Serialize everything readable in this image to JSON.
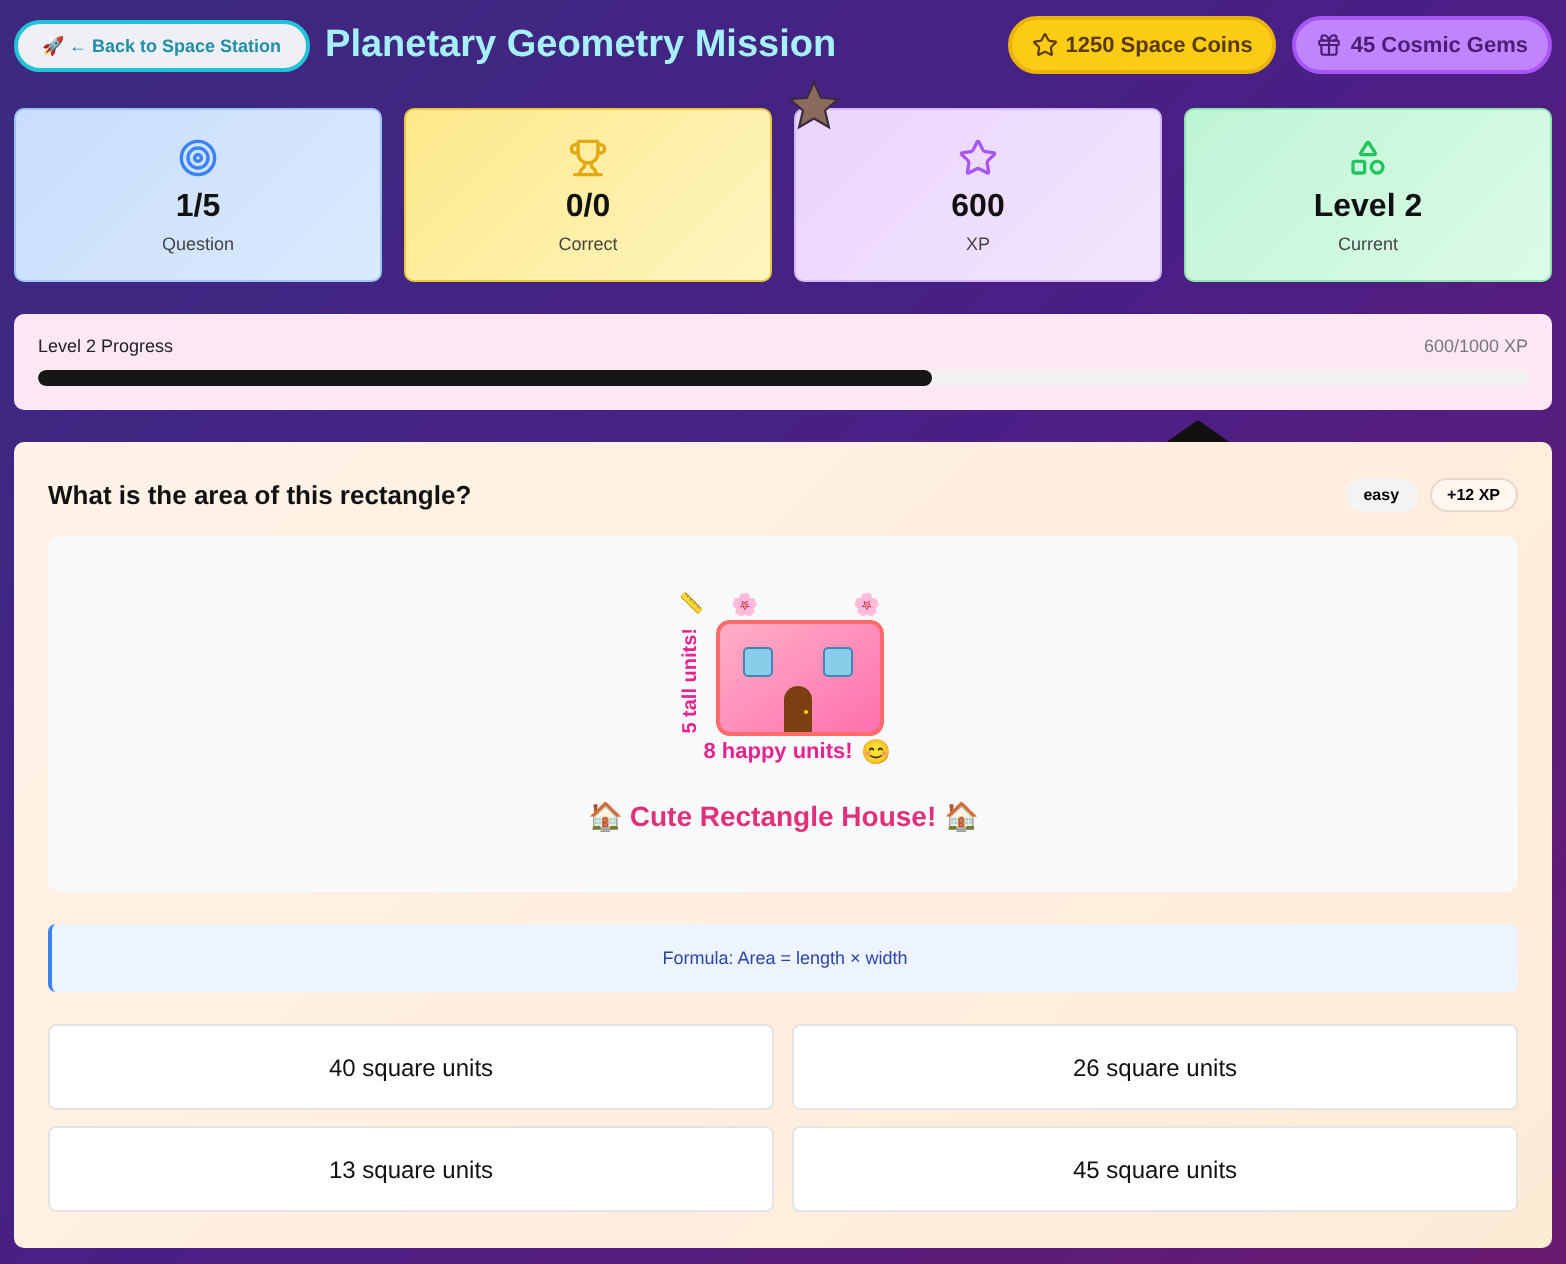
{
  "header": {
    "back_button": "🚀 ← Back to Space Station",
    "title": "Planetary Geometry Mission",
    "coins": "1250 Space Coins",
    "gems": "45 Cosmic Gems"
  },
  "stats": [
    {
      "kind": "target",
      "value": "1/5",
      "label": "Question"
    },
    {
      "kind": "trophy",
      "value": "0/0",
      "label": "Correct"
    },
    {
      "kind": "star",
      "value": "600",
      "label": "XP"
    },
    {
      "kind": "shapes",
      "value": "Level 2",
      "label": "Current"
    }
  ],
  "progress": {
    "label": "Level 2 Progress",
    "reading": "600/1000 XP",
    "level": 0.6
  },
  "question": {
    "text": "What is the area of this rectangle?",
    "difficulty": "easy",
    "reward": "+12 XP",
    "illustration": {
      "ruler": "📏",
      "flowers": [
        "🌸",
        "🌸"
      ],
      "height_label": "5 tall units!",
      "width_label": "8 happy units!",
      "smiley": "😊",
      "caption": "🏠 Cute Rectangle House! 🏠"
    },
    "formula": "Formula: Area = length × width",
    "answers": [
      "40 square units",
      "26 square units",
      "13 square units",
      "45 square units"
    ]
  }
}
